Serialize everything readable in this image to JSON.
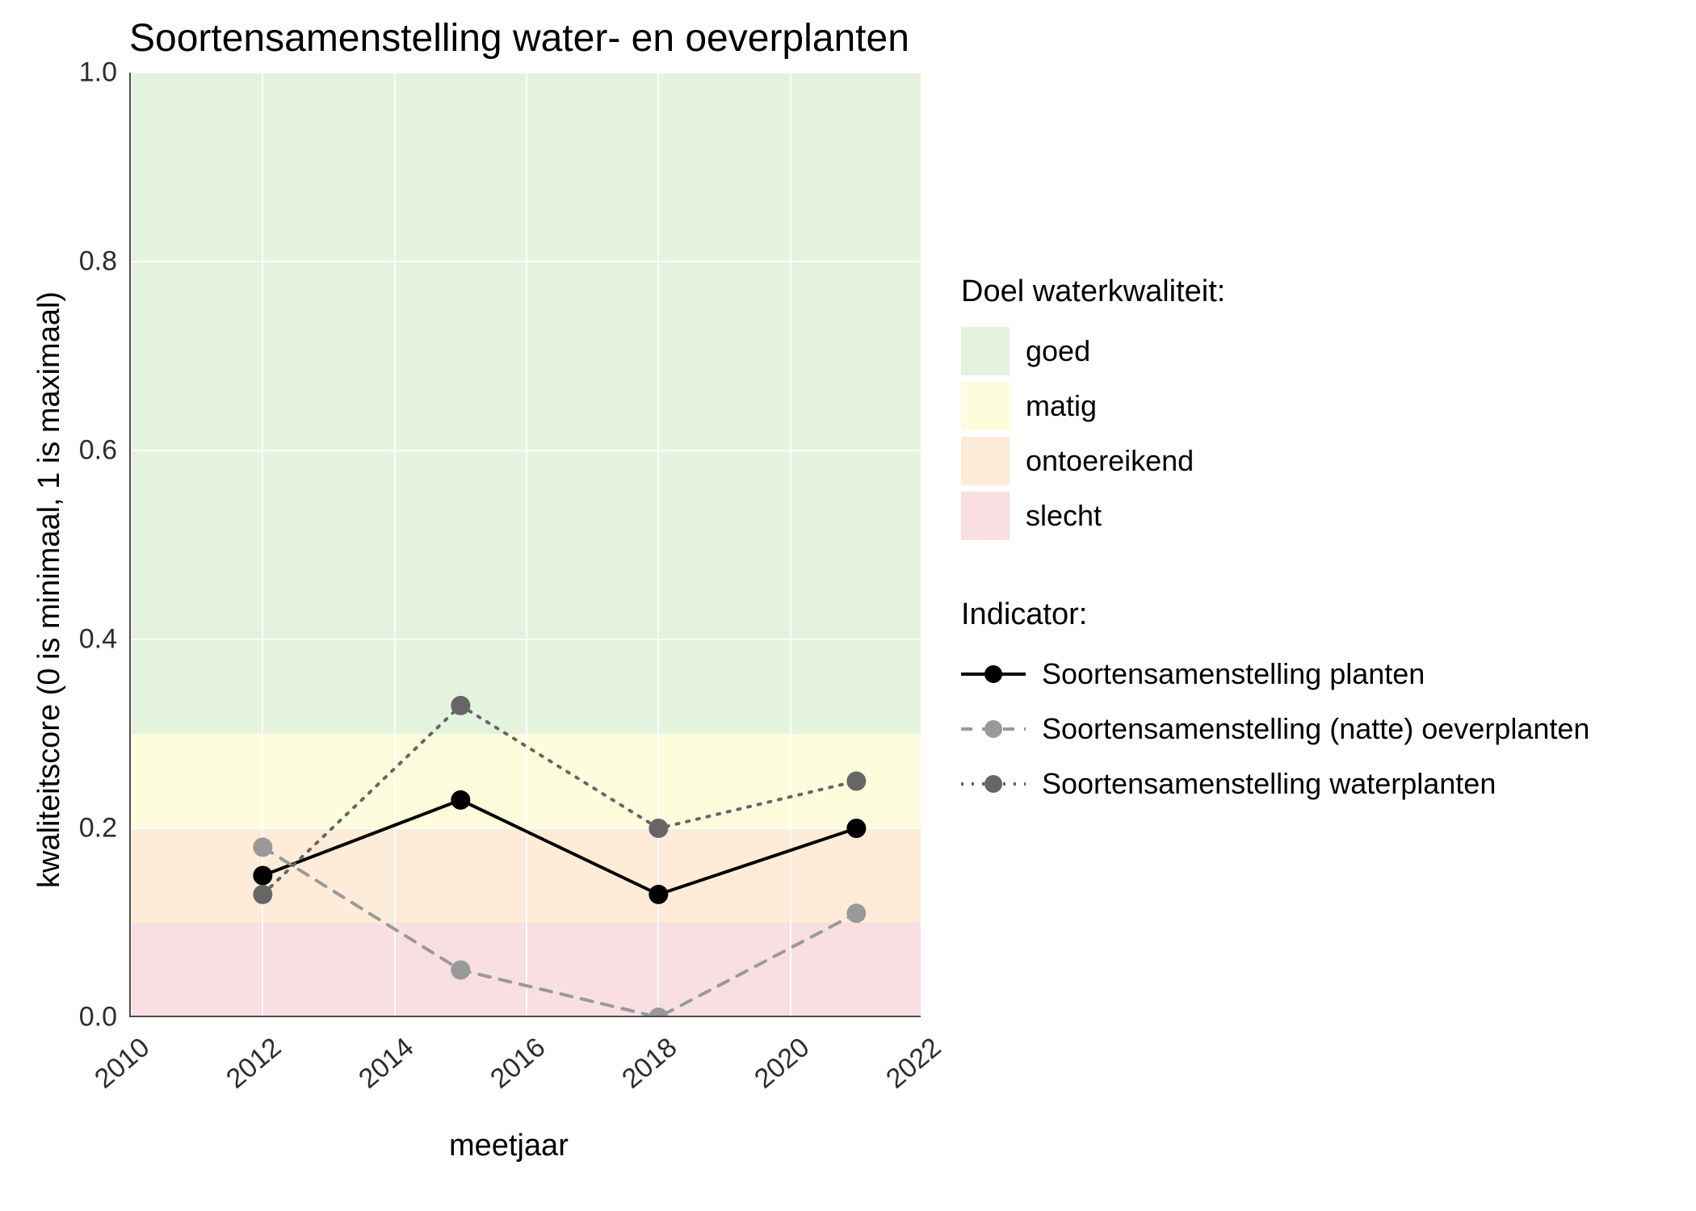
{
  "chart_data": {
    "type": "line",
    "title": "Soortensamenstelling water- en oeverplanten",
    "xlabel": "meetjaar",
    "ylabel": "kwaliteitscore (0 is minimaal, 1 is maximaal)",
    "xlim": [
      2010,
      2022
    ],
    "ylim": [
      0.0,
      1.0
    ],
    "x_ticks": [
      2010,
      2012,
      2014,
      2016,
      2018,
      2020,
      2022
    ],
    "y_ticks": [
      0.0,
      0.2,
      0.4,
      0.6,
      0.8,
      1.0
    ],
    "x": [
      2012,
      2015,
      2018,
      2021
    ],
    "bands": [
      {
        "name": "goed",
        "from": 0.3,
        "to": 1.0,
        "color": "#e4f3de"
      },
      {
        "name": "matig",
        "from": 0.2,
        "to": 0.3,
        "color": "#fdfdde"
      },
      {
        "name": "ontoereikend",
        "from": 0.1,
        "to": 0.2,
        "color": "#feecd8"
      },
      {
        "name": "slecht",
        "from": 0.0,
        "to": 0.1,
        "color": "#f9dee2"
      }
    ],
    "series": [
      {
        "name": "Soortensamenstelling planten",
        "color": "#000000",
        "line": "solid",
        "values": [
          0.15,
          0.23,
          0.13,
          0.2
        ]
      },
      {
        "name": "Soortensamenstelling (natte) oeverplanten",
        "color": "#999999",
        "line": "dashed",
        "values": [
          0.18,
          0.05,
          0.0,
          0.11
        ]
      },
      {
        "name": "Soortensamenstelling waterplanten",
        "color": "#666666",
        "line": "dotted",
        "values": [
          0.13,
          0.33,
          0.2,
          0.25
        ]
      }
    ],
    "legend_bands_title": "Doel waterkwaliteit:",
    "legend_series_title": "Indicator:"
  }
}
